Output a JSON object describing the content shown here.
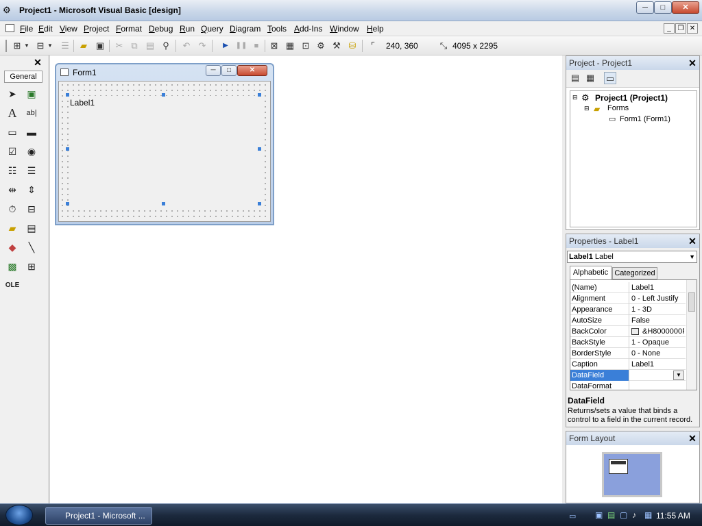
{
  "window": {
    "title": "Project1 - Microsoft Visual Basic [design]",
    "min_label": "─",
    "max_label": "□",
    "close_label": "✕"
  },
  "menu": {
    "items": [
      "File",
      "Edit",
      "View",
      "Project",
      "Format",
      "Debug",
      "Run",
      "Query",
      "Diagram",
      "Tools",
      "Add-Ins",
      "Window",
      "Help"
    ],
    "mdi_min": "_",
    "mdi_restore": "❐",
    "mdi_close": "✕"
  },
  "toolbar": {
    "position_readout": "240, 360",
    "size_readout": "4095 x 2295"
  },
  "toolbox": {
    "tab_label": "General",
    "close_label": "✕"
  },
  "form": {
    "title": "Form1",
    "label_caption": "Label1"
  },
  "project_panel": {
    "title": "Project - Project1",
    "close_label": "✕",
    "tree": {
      "root": "Project1 (Project1)",
      "folder": "Forms",
      "item": "Form1 (Form1)"
    }
  },
  "properties_panel": {
    "title": "Properties - Label1",
    "close_label": "✕",
    "object_name": "Label1",
    "object_type": "Label",
    "tabs": [
      "Alphabetic",
      "Categorized"
    ],
    "rows": [
      {
        "name": "(Name)",
        "value": "Label1"
      },
      {
        "name": "Alignment",
        "value": "0 - Left Justify"
      },
      {
        "name": "Appearance",
        "value": "1 - 3D"
      },
      {
        "name": "AutoSize",
        "value": "False"
      },
      {
        "name": "BackColor",
        "value": "&H8000000F"
      },
      {
        "name": "BackStyle",
        "value": "1 - Opaque"
      },
      {
        "name": "BorderStyle",
        "value": "0 - None"
      },
      {
        "name": "Caption",
        "value": "Label1"
      },
      {
        "name": "DataField",
        "value": ""
      },
      {
        "name": "DataFormat",
        "value": ""
      }
    ],
    "selected_row": "DataField",
    "description_title": "DataField",
    "description_text": "Returns/sets a value that binds a control to a field in the current record."
  },
  "form_layout_panel": {
    "title": "Form Layout",
    "close_label": "✕"
  },
  "taskbar": {
    "task_label": "Project1 - Microsoft ...",
    "clock": "11:55 AM"
  },
  "colors": {
    "selection": "#3a7fd8",
    "taskbar": "#1c2a3e",
    "layout_monitor": "#8aa0dc"
  }
}
